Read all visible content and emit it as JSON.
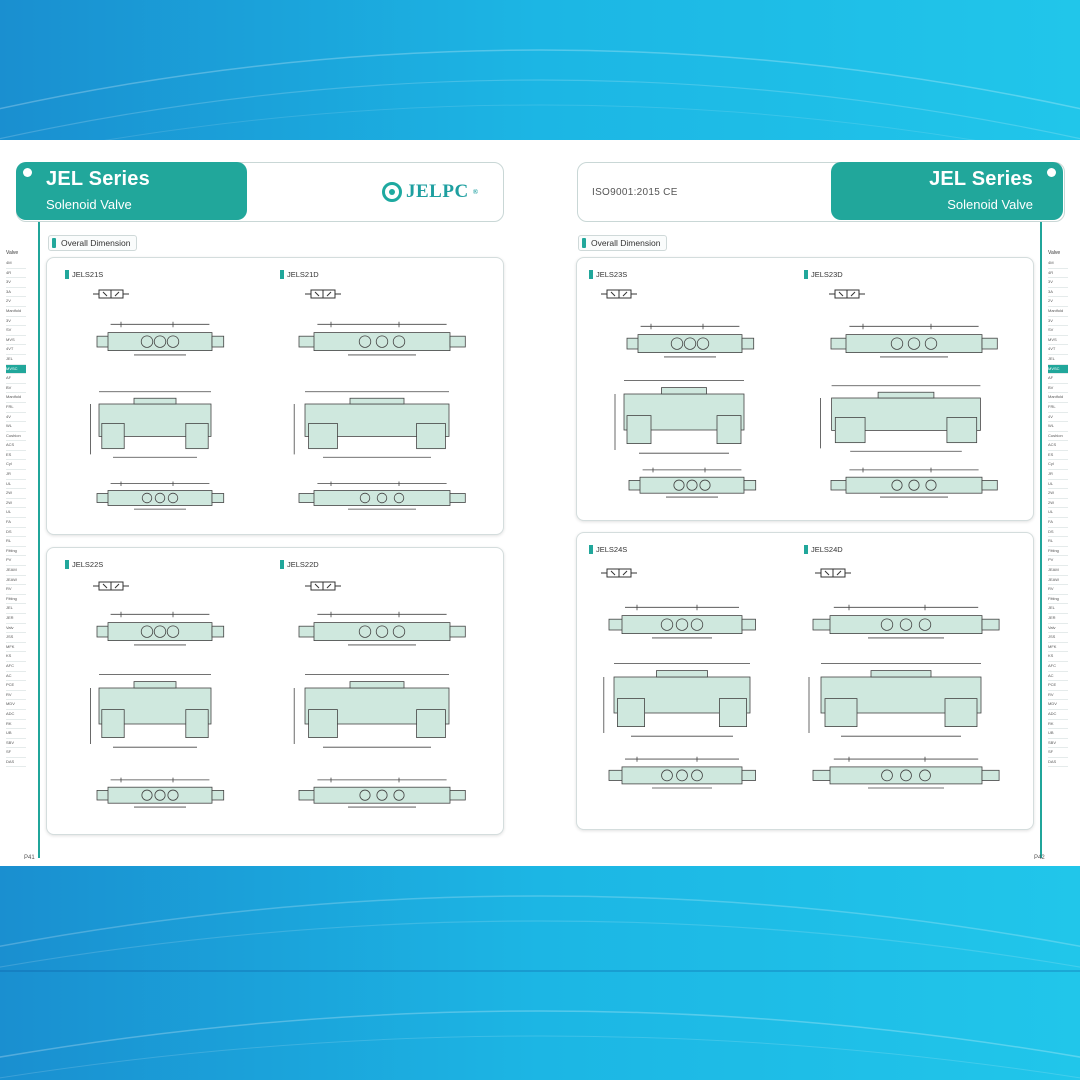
{
  "left_page": {
    "series_title": "JEL Series",
    "series_subtitle": "Solenoid Valve",
    "brand": "JELPC",
    "brand_mark": "®",
    "section_label": "Overall Dimension",
    "models": [
      "JELS21S",
      "JELS21D",
      "JELS22S",
      "JELS22D"
    ],
    "page_number": "P41"
  },
  "right_page": {
    "series_title": "JEL Series",
    "series_subtitle": "Solenoid Valve",
    "certification": "ISO9001:2015  CE",
    "section_label": "Overall Dimension",
    "models": [
      "JELS23S",
      "JELS23D",
      "JELS24S",
      "JELS24D"
    ],
    "page_number": "P42"
  },
  "side_index": {
    "header": "Valve",
    "items": [
      "4M",
      "4R",
      "3V",
      "3A",
      "2V",
      "Manifold",
      "3V",
      "SV",
      "MVS",
      "4VT",
      "JEL",
      "MVSC",
      "AF",
      "BV",
      "Manifold",
      "FRL",
      "4V",
      "WL",
      "Cushion",
      "ACS",
      "ES",
      "Cyl",
      "JR",
      "UL",
      "2W",
      "2W",
      "UL",
      "FA",
      "DS",
      "RL",
      "Fitting",
      "PV",
      "JEAM",
      "JEAW",
      "RV",
      "Fitting",
      "JEL",
      "JER",
      "Valv",
      "JSS",
      "MFK",
      "KS",
      "AFC",
      "AC",
      "PCE",
      "RV",
      "MDV",
      "ADC",
      "RK",
      "UB",
      "SBV",
      "SF",
      "DAS"
    ],
    "active_index": 11,
    "colors": {
      "accent": "#21a79b",
      "index_text": "#555555"
    }
  },
  "colors": {
    "accent": "#21a79b",
    "valve_fill": "#cfe8de",
    "background_blue": "#17a6dc"
  },
  "icons": [
    "jelpc-logo-icon",
    "valve-symbol-icon",
    "ce-mark-icon"
  ]
}
